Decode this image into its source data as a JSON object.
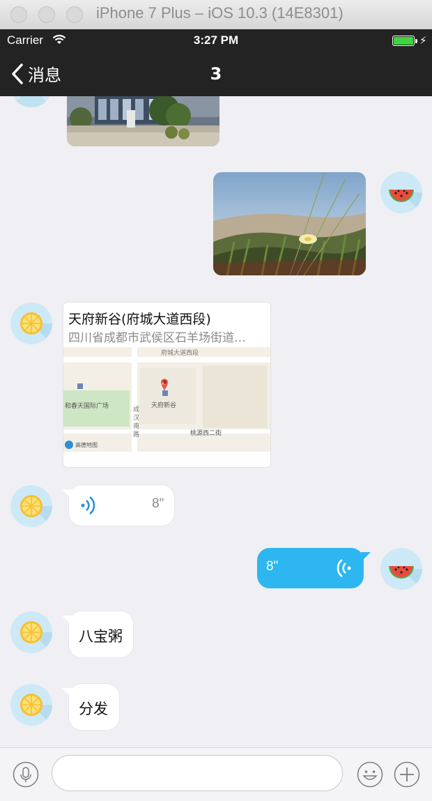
{
  "simulator": {
    "title": "iPhone 7 Plus – iOS 10.3 (14E8301)"
  },
  "status_bar": {
    "carrier": "Carrier",
    "time": "3:27 PM"
  },
  "nav": {
    "back_label": "消息",
    "title": "3"
  },
  "messages": {
    "location": {
      "title": "天府新谷(府城大道西段)",
      "address": "四川省成都市武侯区石羊场街道…",
      "map_labels": [
        "府城大道西段",
        "和春天国际广场",
        "天府新谷",
        "成",
        "汉",
        "南",
        "路",
        "桃源西二街",
        "高德地图",
        "A"
      ]
    },
    "voice_in": {
      "duration": "8\""
    },
    "voice_out": {
      "duration": "8\""
    },
    "text1": "八宝粥",
    "text2": "分发"
  },
  "input_bar": {
    "placeholder": ""
  },
  "icons": {
    "back": "chevron-left-icon",
    "mic": "microphone-icon",
    "emoji": "smiley-icon",
    "add": "plus-icon",
    "incoming_avatar": "lemon-avatar-icon",
    "outgoing_avatar": "watermelon-avatar-icon"
  },
  "colors": {
    "nav_bg": "#232323",
    "outgoing_bubble": "#2db6f0",
    "voice_wave_in": "#2d8fd5",
    "background": "#efeff4"
  }
}
